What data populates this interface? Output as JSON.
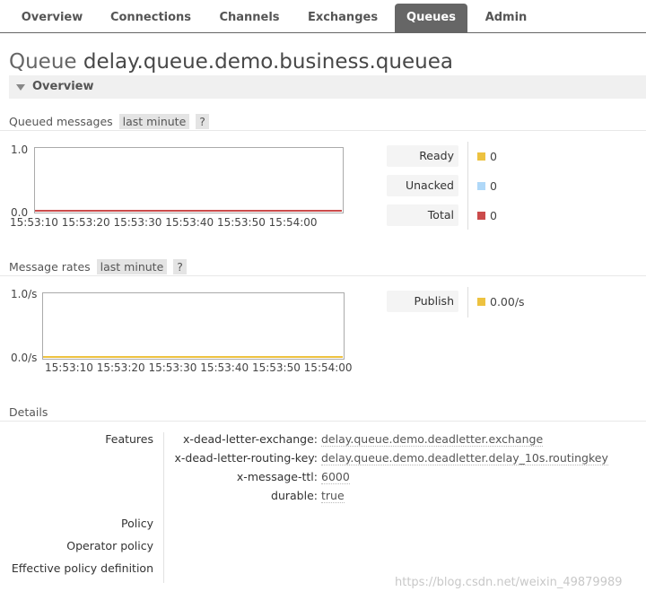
{
  "nav": {
    "tabs": [
      {
        "label": "Overview"
      },
      {
        "label": "Connections"
      },
      {
        "label": "Channels"
      },
      {
        "label": "Exchanges"
      },
      {
        "label": "Queues"
      },
      {
        "label": "Admin"
      }
    ],
    "active_tab": "Queues"
  },
  "page": {
    "title_prefix": "Queue",
    "queue_name": "delay.queue.demo.business.queuea"
  },
  "overview_section": {
    "label": "Overview"
  },
  "queued_messages": {
    "heading": "Queued messages",
    "range_label": "last minute",
    "help": "?",
    "chart_data": {
      "type": "area",
      "x": [
        "15:53:10",
        "15:53:20",
        "15:53:30",
        "15:53:40",
        "15:53:50",
        "15:54:00"
      ],
      "ylim": [
        0.0,
        1.0
      ],
      "y_tick_labels": [
        "1.0",
        "0.0"
      ],
      "series": [
        {
          "name": "Ready",
          "values": [
            0,
            0,
            0,
            0,
            0,
            0
          ],
          "color": "#edc240"
        },
        {
          "name": "Unacked",
          "values": [
            0,
            0,
            0,
            0,
            0,
            0
          ],
          "color": "#afd8f8"
        },
        {
          "name": "Total",
          "values": [
            0,
            0,
            0,
            0,
            0,
            0
          ],
          "color": "#cb4b4b"
        }
      ]
    },
    "legend": [
      {
        "label": "Ready",
        "value": "0",
        "color": "#edc240"
      },
      {
        "label": "Unacked",
        "value": "0",
        "color": "#afd8f8"
      },
      {
        "label": "Total",
        "value": "0",
        "color": "#cb4b4b"
      }
    ]
  },
  "message_rates": {
    "heading": "Message rates",
    "range_label": "last minute",
    "help": "?",
    "chart_data": {
      "type": "area",
      "x": [
        "15:53:10",
        "15:53:20",
        "15:53:30",
        "15:53:40",
        "15:53:50",
        "15:54:00"
      ],
      "ylim": [
        0.0,
        1.0
      ],
      "y_tick_labels": [
        "1.0/s",
        "0.0/s"
      ],
      "series": [
        {
          "name": "Publish",
          "values": [
            0,
            0,
            0,
            0,
            0,
            0
          ],
          "color": "#edc240"
        }
      ]
    },
    "legend": [
      {
        "label": "Publish",
        "value": "0.00/s",
        "color": "#edc240"
      }
    ]
  },
  "details": {
    "heading": "Details",
    "features_label": "Features",
    "features": [
      {
        "key": "x-dead-letter-exchange:",
        "value": "delay.queue.demo.deadletter.exchange"
      },
      {
        "key": "x-dead-letter-routing-key:",
        "value": "delay.queue.demo.deadletter.delay_10s.routingkey"
      },
      {
        "key": "x-message-ttl:",
        "value": "6000"
      },
      {
        "key": "durable:",
        "value": "true"
      }
    ],
    "policy_label": "Policy",
    "operator_policy_label": "Operator policy",
    "effective_policy_label": "Effective policy definition"
  },
  "watermark": "https://blog.csdn.net/weixin_49879989"
}
